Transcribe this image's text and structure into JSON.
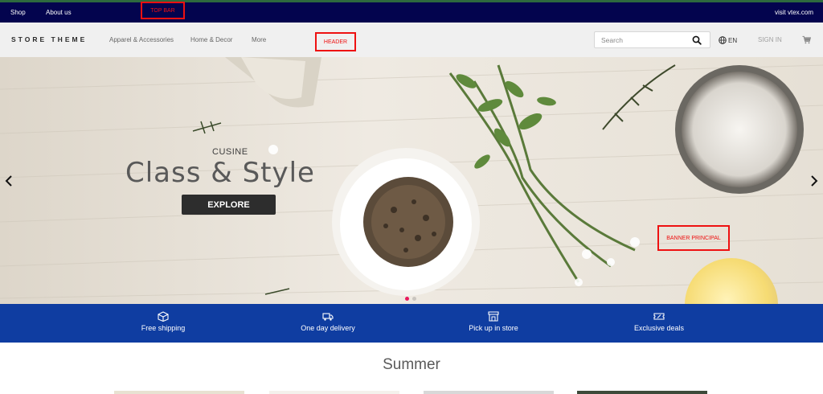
{
  "topbar": {
    "links": [
      "Shop",
      "About us"
    ],
    "right_link": "visit vtex.com",
    "annotation": "TOP BAR",
    "bg_color": "#03044e"
  },
  "header": {
    "logo": "STORE THEME",
    "nav": [
      "Apparel & Accessories",
      "Home & Decor",
      "More"
    ],
    "annotation": "HEADER",
    "search_placeholder": "Search",
    "language": "EN",
    "sign_in": "SIGN IN",
    "icons": [
      "search-icon",
      "globe-icon",
      "cart-icon"
    ]
  },
  "banner": {
    "eyebrow": "CUSINE",
    "headline": "Class & Style",
    "cta": "EXPLORE",
    "annotation": "BANNER PRINCIPAL",
    "slide_count": 2,
    "active_slide": 1,
    "active_dot_color": "#e8195d"
  },
  "benefits": {
    "bg_color": "#0f3da1",
    "items": [
      {
        "label": "Free shipping",
        "icon": "box-icon"
      },
      {
        "label": "One day delivery",
        "icon": "truck-icon"
      },
      {
        "label": "Pick up in store",
        "icon": "store-icon"
      },
      {
        "label": "Exclusive deals",
        "icon": "ticket-icon"
      }
    ]
  },
  "section": {
    "title": "Summer"
  }
}
